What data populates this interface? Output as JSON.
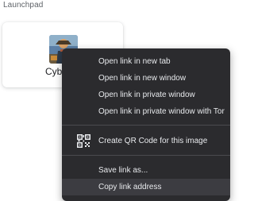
{
  "section": {
    "title": "Launchpad"
  },
  "tile": {
    "label": "Cybe"
  },
  "context_menu": {
    "items": [
      {
        "label": "Open link in new tab"
      },
      {
        "label": "Open link in new window"
      },
      {
        "label": "Open link in private window"
      },
      {
        "label": "Open link in private window with Tor"
      },
      {
        "label": "Create QR Code for this image",
        "icon": "qr-code-icon"
      },
      {
        "label": "Save link as..."
      },
      {
        "label": "Copy link address",
        "highlighted": true
      }
    ]
  },
  "colors": {
    "menu_background": "#2b2b2e",
    "menu_text": "#e8eaed",
    "menu_highlight": "#3c3c41",
    "page_background": "#ffffff"
  }
}
